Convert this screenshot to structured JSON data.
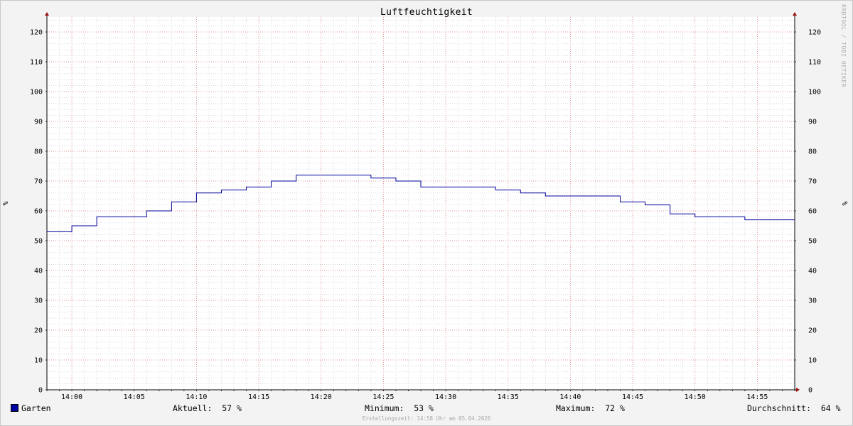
{
  "chart_data": {
    "type": "line",
    "title": "Luftfeuchtigkeit",
    "ylabel_left": "%",
    "ylabel_right": "%",
    "ylim": [
      0,
      125
    ],
    "yticks": [
      0,
      10,
      20,
      30,
      40,
      50,
      60,
      70,
      80,
      90,
      100,
      110,
      120
    ],
    "xlim": [
      "13:58",
      "14:58"
    ],
    "xticks": [
      "14:00",
      "14:05",
      "14:10",
      "14:15",
      "14:20",
      "14:25",
      "14:30",
      "14:35",
      "14:40",
      "14:45",
      "14:50",
      "14:55"
    ],
    "grid": true,
    "step": true,
    "series": [
      {
        "name": "Garten",
        "color": "#00009c",
        "points": [
          [
            "13:58",
            53
          ],
          [
            "14:00",
            55
          ],
          [
            "14:02",
            58
          ],
          [
            "14:06",
            60
          ],
          [
            "14:08",
            63
          ],
          [
            "14:10",
            66
          ],
          [
            "14:12",
            67
          ],
          [
            "14:14",
            68
          ],
          [
            "14:16",
            70
          ],
          [
            "14:18",
            72
          ],
          [
            "14:24",
            71
          ],
          [
            "14:26",
            70
          ],
          [
            "14:28",
            68
          ],
          [
            "14:30",
            68
          ],
          [
            "14:34",
            67
          ],
          [
            "14:36",
            66
          ],
          [
            "14:38",
            65
          ],
          [
            "14:44",
            63
          ],
          [
            "14:46",
            62
          ],
          [
            "14:48",
            59
          ],
          [
            "14:50",
            58
          ],
          [
            "14:54",
            57
          ],
          [
            "14:58",
            57
          ]
        ]
      }
    ]
  },
  "watermark": "RRDTOOL / TOBI OETIKER",
  "legend": {
    "series_name": "Garten",
    "aktuell": "Aktuell:  57 %",
    "minimum": "Minimum:  53 %",
    "maximum": "Maximum:  72 %",
    "durchschnitt": "Durchschnitt:  64 %"
  },
  "footer": "Erstellungszeit: 14:58 Uhr am 05.04.2026"
}
